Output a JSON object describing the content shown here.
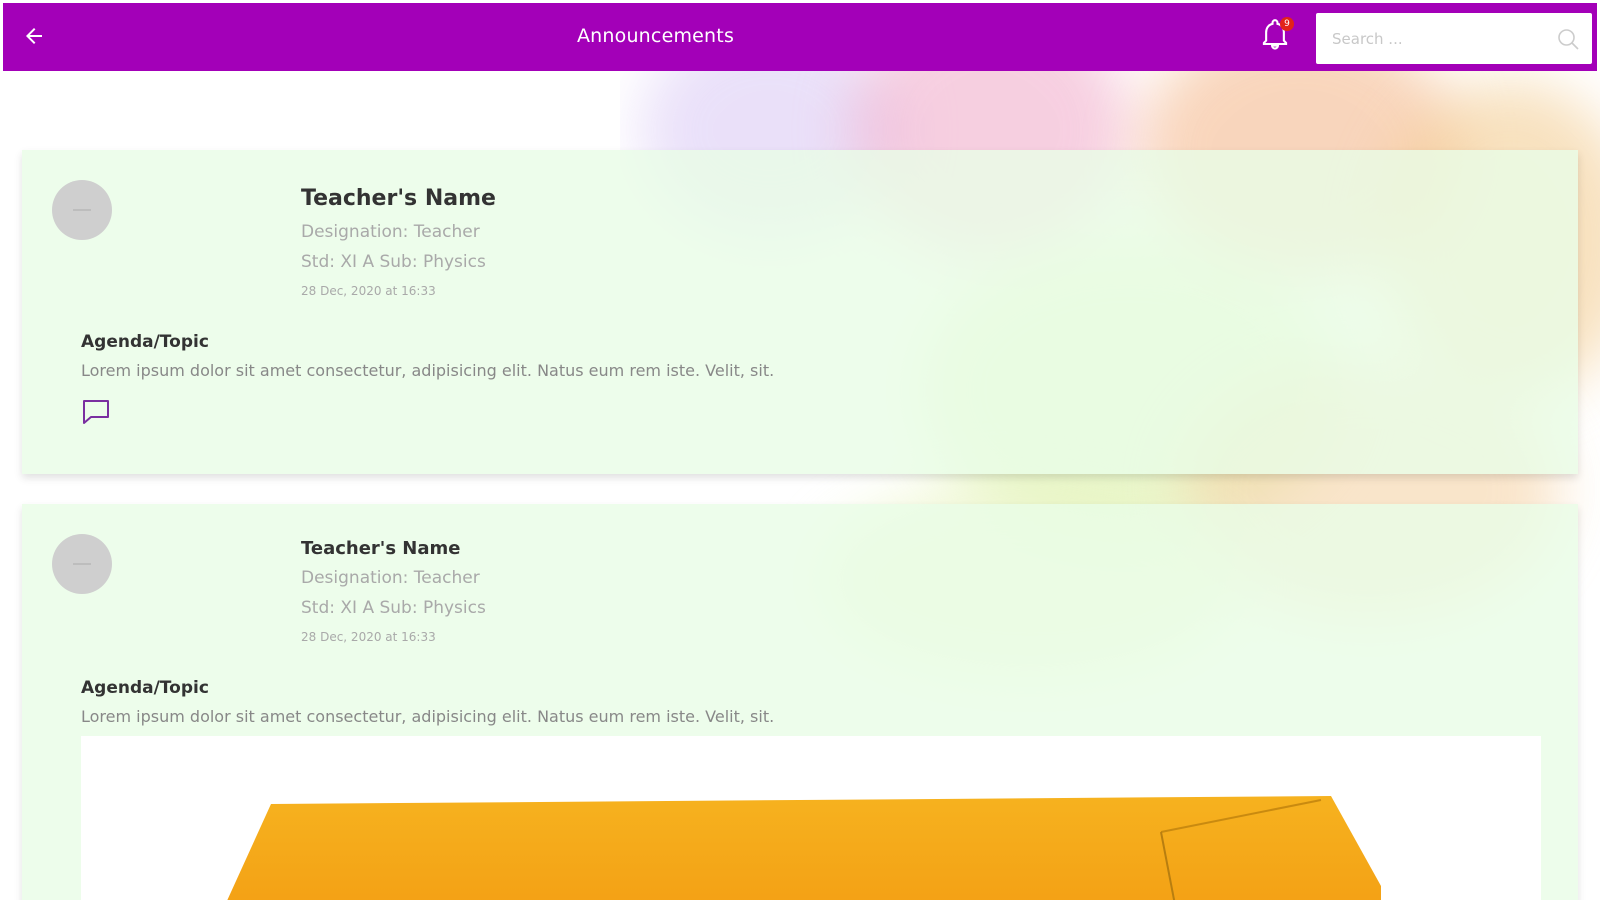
{
  "header": {
    "title": "Announcements",
    "notification_count": "9",
    "search_placeholder": "Search ..."
  },
  "colors": {
    "brand": "#a300b8",
    "card_bg": "#e9fce7",
    "badge": "#e2231a",
    "envelope": "#f4a81c"
  },
  "icons": {
    "back": "arrow-left-icon",
    "notifications": "bell-icon",
    "search": "search-icon",
    "comment": "comment-icon"
  },
  "announcements": [
    {
      "teacher_name": "Teacher's Name",
      "designation": "Designation: Teacher",
      "class_subject": "Std: XI A Sub: Physics",
      "date": "28 Dec, 2020 at 16:33",
      "agenda_label": "Agenda/Topic",
      "agenda_text": "Lorem ipsum dolor sit amet consectetur, adipisicing elit. Natus eum rem iste. Velit, sit."
    },
    {
      "teacher_name": "Teacher's Name",
      "designation": "Designation: Teacher",
      "class_subject": "Std: XI A Sub: Physics",
      "date": "28 Dec, 2020 at 16:33",
      "agenda_label": "Agenda/Topic",
      "agenda_text": "Lorem ipsum dolor sit amet consectetur, adipisicing elit. Natus eum rem iste. Velit, sit."
    }
  ]
}
